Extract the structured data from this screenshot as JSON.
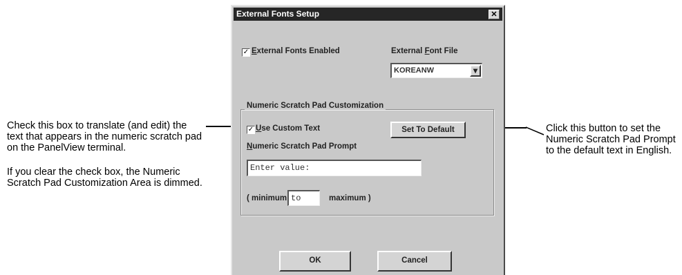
{
  "callouts": {
    "left": {
      "para1": "Check this box to translate (and edit) the text that appears in the numeric scratch pad on the PanelView terminal.",
      "para2": "If you clear the check box, the Numeric Scratch Pad Customization Area is dimmed."
    },
    "right": {
      "text": "Click this button to set the Numeric Scratch Pad Prompt to the default text in English."
    }
  },
  "dialog": {
    "title": "External Fonts Setup",
    "close_glyph": "✕",
    "external_fonts_enabled": {
      "checked": true,
      "mark": "✓",
      "underline_char": "E",
      "label_rest": "xternal Fonts Enabled"
    },
    "external_font_file": {
      "label_prefix": "External ",
      "underline_char": "F",
      "label_rest": "ont File",
      "value": "KOREANW",
      "arrow": "▾"
    },
    "group_title": "Numeric Scratch Pad Customization",
    "use_custom_text": {
      "checked": true,
      "mark": "✓",
      "underline_char": "U",
      "label_rest": "se Custom Text"
    },
    "set_default_button": "Set To Default",
    "prompt_label": {
      "underline_char": "N",
      "label_rest": "umeric Scratch Pad Prompt"
    },
    "prompt_value": "Enter value:",
    "range": {
      "open": "( minimum",
      "separator_value": "to",
      "close": "maximum )"
    },
    "ok_button": "OK",
    "cancel_button": "Cancel"
  }
}
